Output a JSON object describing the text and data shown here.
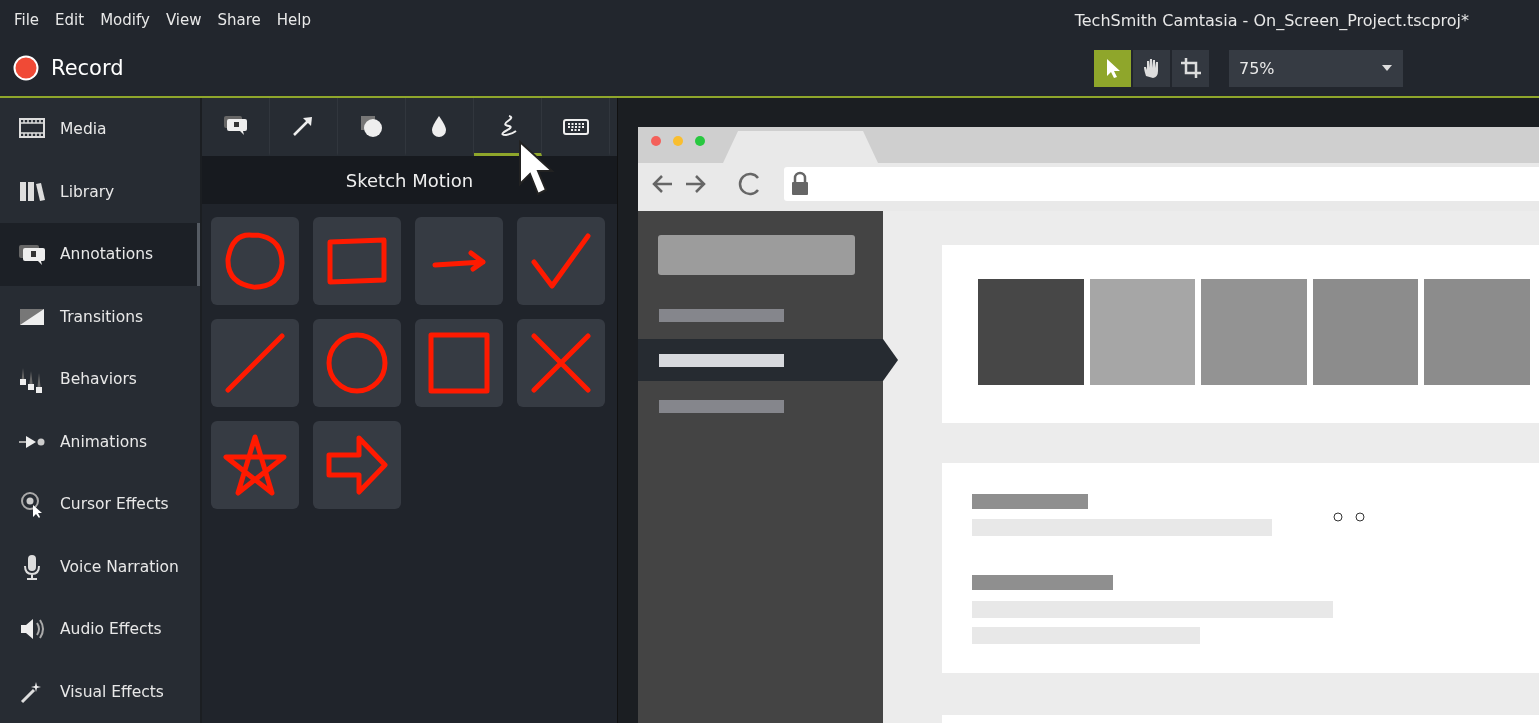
{
  "menu": [
    "File",
    "Edit",
    "Modify",
    "View",
    "Share",
    "Help"
  ],
  "window": {
    "title": "TechSmith Camtasia - On_Screen_Project.tscproj*"
  },
  "record": {
    "label": "Record"
  },
  "canvas_tools": [
    {
      "kind": "pointer",
      "selected": true
    },
    {
      "kind": "hand",
      "selected": false
    },
    {
      "kind": "crop",
      "selected": false
    }
  ],
  "zoom": {
    "value": "75%"
  },
  "sidebar": {
    "items": [
      {
        "kind": "media",
        "label": "Media",
        "selected": false
      },
      {
        "kind": "library",
        "label": "Library",
        "selected": false
      },
      {
        "kind": "annotations",
        "label": "Annotations",
        "selected": true
      },
      {
        "kind": "transitions",
        "label": "Transitions",
        "selected": false
      },
      {
        "kind": "behaviors",
        "label": "Behaviors",
        "selected": false
      },
      {
        "kind": "animations",
        "label": "Animations",
        "selected": false
      },
      {
        "kind": "cursor",
        "label": "Cursor Effects",
        "selected": false
      },
      {
        "kind": "voice",
        "label": "Voice Narration",
        "selected": false
      },
      {
        "kind": "audio",
        "label": "Audio Effects",
        "selected": false
      },
      {
        "kind": "visual",
        "label": "Visual Effects",
        "selected": false
      }
    ]
  },
  "annotation_tabs": [
    {
      "kind": "callout",
      "selected": false
    },
    {
      "kind": "arrow",
      "selected": false
    },
    {
      "kind": "shape",
      "selected": false
    },
    {
      "kind": "blur",
      "selected": false
    },
    {
      "kind": "sketch",
      "selected": true
    },
    {
      "kind": "keystroke",
      "selected": false
    }
  ],
  "panel": {
    "title": "Sketch Motion"
  },
  "sketches": [
    {
      "kind": "ellipse"
    },
    {
      "kind": "rectangle"
    },
    {
      "kind": "arrow"
    },
    {
      "kind": "check"
    },
    {
      "kind": "line"
    },
    {
      "kind": "circle"
    },
    {
      "kind": "square"
    },
    {
      "kind": "cross"
    },
    {
      "kind": "star"
    },
    {
      "kind": "block-arrow"
    }
  ]
}
